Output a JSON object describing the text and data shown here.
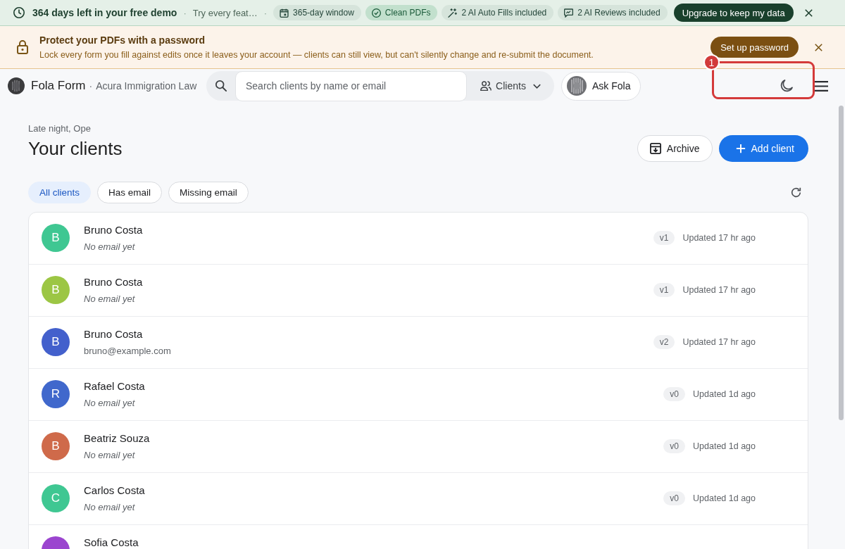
{
  "trial_banner": {
    "status": "364 days left in your free demo",
    "separators": [
      "·",
      "·"
    ],
    "teaser": "Try every feat…",
    "chips": [
      {
        "kind": "window",
        "label": "365-day window",
        "highlighted": false
      },
      {
        "kind": "pdf",
        "label": "Clean PDFs",
        "highlighted": true
      },
      {
        "kind": "autofill",
        "label": "2 AI Auto Fills included",
        "highlighted": false
      },
      {
        "kind": "review",
        "label": "2 AI Reviews included",
        "highlighted": false
      }
    ],
    "upgrade_button": "Upgrade to keep my data"
  },
  "password_banner": {
    "title": "Protect your PDFs with a password",
    "description": "Lock every form you fill against edits once it leaves your account — clients can still view, but can't silently change and re-submit the document.",
    "button": "Set up password"
  },
  "nav": {
    "brand": "Fola Form",
    "org_separator": "·",
    "org": "Acura Immigration Law",
    "search": {
      "placeholder": "Search clients by name or email"
    },
    "scope_dropdown": "Clients",
    "assistant_button": "Ask Fola"
  },
  "page": {
    "greeting": "Late night, Ope",
    "title": "Your clients",
    "actions": [
      {
        "kind": "archive",
        "label": "Archive"
      },
      {
        "kind": "add",
        "label": "Add client"
      }
    ],
    "filters": [
      {
        "label": "All clients",
        "selected": true
      },
      {
        "label": "Has email",
        "selected": false
      },
      {
        "label": "Missing email",
        "selected": false
      }
    ]
  },
  "clients": [
    {
      "initial": "B",
      "name": "Bruno Costa",
      "email": "No email yet",
      "has_email": false,
      "version": "v1",
      "updated": "Updated 17 hr ago",
      "color": "#3fc792"
    },
    {
      "initial": "B",
      "name": "Bruno Costa",
      "email": "No email yet",
      "has_email": false,
      "version": "v1",
      "updated": "Updated 17 hr ago",
      "color": "#9cc644"
    },
    {
      "initial": "B",
      "name": "Bruno Costa",
      "email": "bruno@example.com",
      "has_email": true,
      "version": "v2",
      "updated": "Updated 17 hr ago",
      "color": "#4360cc"
    },
    {
      "initial": "R",
      "name": "Rafael Costa",
      "email": "No email yet",
      "has_email": false,
      "version": "v0",
      "updated": "Updated 1d ago",
      "color": "#4068cc"
    },
    {
      "initial": "B",
      "name": "Beatriz Souza",
      "email": "No email yet",
      "has_email": false,
      "version": "v0",
      "updated": "Updated 1d ago",
      "color": "#cf6a4a"
    },
    {
      "initial": "C",
      "name": "Carlos Costa",
      "email": "No email yet",
      "has_email": false,
      "version": "v0",
      "updated": "Updated 1d ago",
      "color": "#3fc792"
    },
    {
      "name": "Sofia Costa",
      "color": "#9b45cf"
    }
  ],
  "annotation": {
    "number": "1"
  }
}
